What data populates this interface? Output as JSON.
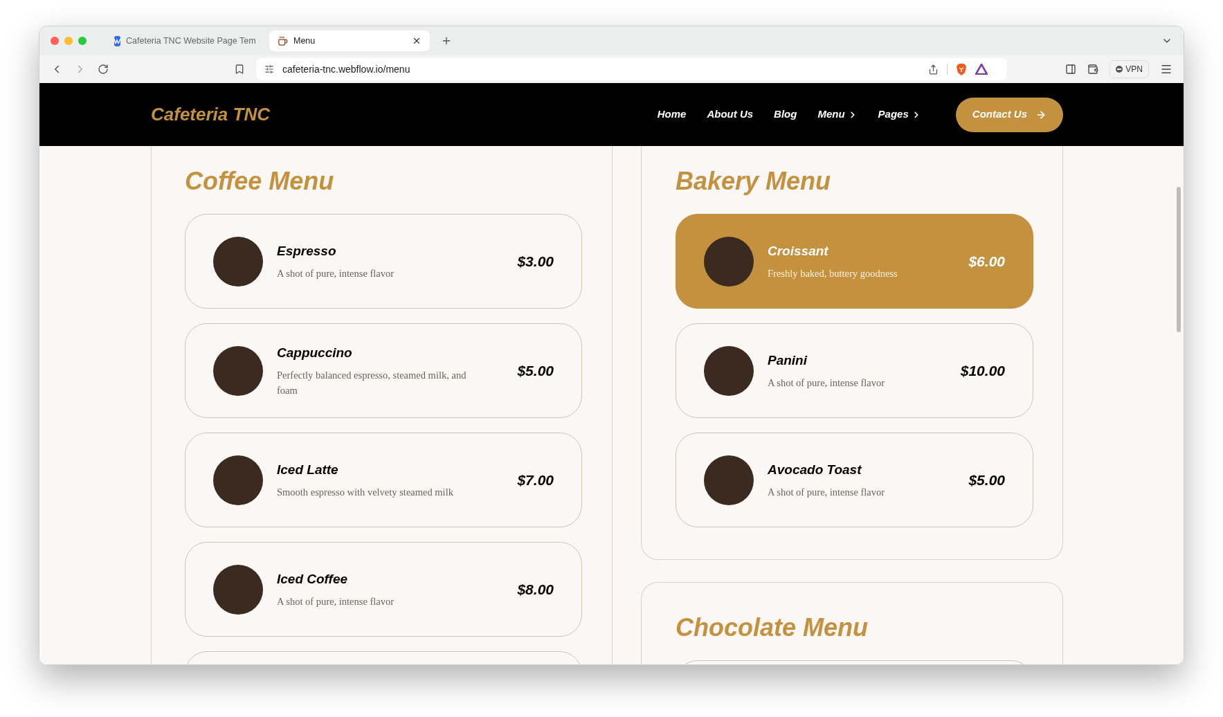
{
  "browser": {
    "tabs": [
      {
        "title": "Cafeteria TNC Website Page Tem",
        "kind": "site",
        "selected": false
      },
      {
        "title": "Menu",
        "kind": "cafe",
        "selected": true
      }
    ],
    "url": "cafeteria-tnc.webflow.io/menu",
    "vpn_label": "VPN"
  },
  "nav": {
    "logo": "Cafeteria TNC",
    "links": [
      {
        "label": "Home",
        "has_submenu": false
      },
      {
        "label": "About Us",
        "has_submenu": false
      },
      {
        "label": "Blog",
        "has_submenu": false
      },
      {
        "label": "Menu",
        "has_submenu": true
      },
      {
        "label": "Pages",
        "has_submenu": true
      }
    ],
    "cta": "Contact Us"
  },
  "sections": [
    {
      "title": "Coffee Menu",
      "items": [
        {
          "name": "Espresso",
          "description": "A shot of pure, intense flavor",
          "price": "$3.00",
          "selected": false
        },
        {
          "name": "Cappuccino",
          "description": "Perfectly balanced espresso, steamed milk, and foam",
          "price": "$5.00",
          "selected": false
        },
        {
          "name": "Iced Latte",
          "description": "Smooth espresso with velvety steamed milk",
          "price": "$7.00",
          "selected": false
        },
        {
          "name": "Iced Coffee",
          "description": "A shot of pure, intense flavor",
          "price": "$8.00",
          "selected": false
        }
      ]
    },
    {
      "title": "Bakery Menu",
      "items": [
        {
          "name": "Croissant",
          "description": "Freshly baked, buttery goodness",
          "price": "$6.00",
          "selected": true
        },
        {
          "name": "Panini",
          "description": "A shot of pure, intense flavor",
          "price": "$10.00",
          "selected": false
        },
        {
          "name": "Avocado Toast",
          "description": "A shot of pure, intense flavor",
          "price": "$5.00",
          "selected": false
        }
      ]
    },
    {
      "title": "Chocolate Menu"
    }
  ]
}
